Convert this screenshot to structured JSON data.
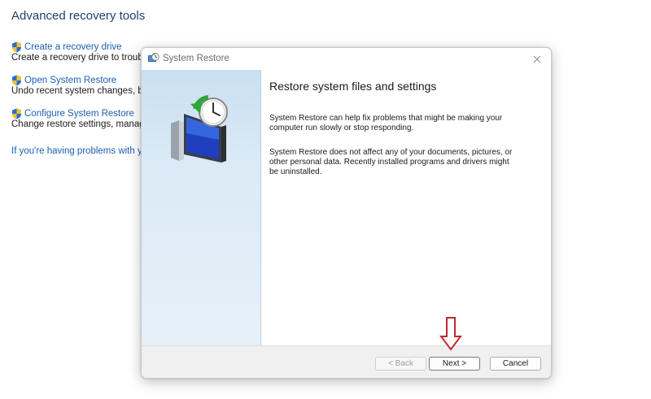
{
  "background": {
    "title": "Advanced recovery tools",
    "items": [
      {
        "link": "Create a recovery drive",
        "desc": "Create a recovery drive to troubles"
      },
      {
        "link": "Open System Restore",
        "desc": "Undo recent system changes, but"
      },
      {
        "link": "Configure System Restore",
        "desc": "Change restore settings, manage c"
      }
    ],
    "help_link": "If you're having problems with yo"
  },
  "dialog": {
    "title": "System Restore",
    "heading": "Restore system files and settings",
    "para1": "System Restore can help fix problems that might be making your computer run slowly or stop responding.",
    "para2": "System Restore does not affect any of your documents, pictures, or other personal data. Recently installed programs and drivers might be uninstalled.",
    "buttons": {
      "back": "< Back",
      "next": "Next >",
      "cancel": "Cancel"
    },
    "close_icon": "close-icon"
  },
  "colors": {
    "link": "#1a5fb4",
    "title": "#1f3f6e",
    "annotation_arrow": "#c0282d",
    "side_panel": "#d5e6f4"
  }
}
